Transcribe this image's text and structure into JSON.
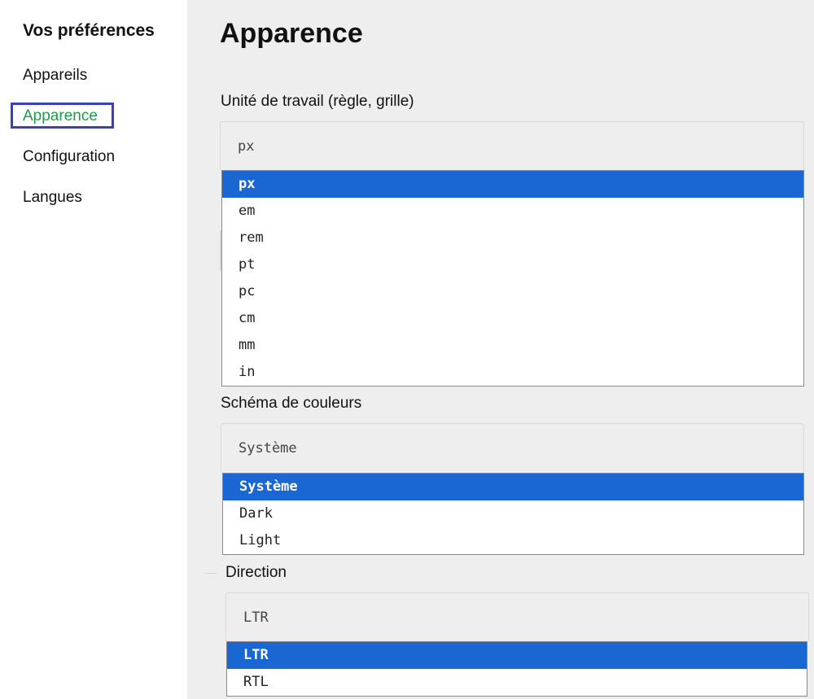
{
  "sidebar": {
    "title": "Vos préférences",
    "items": [
      {
        "label": "Appareils"
      },
      {
        "label": "Apparence"
      },
      {
        "label": "Configuration"
      },
      {
        "label": "Langues"
      }
    ],
    "active_index": 1
  },
  "main": {
    "page_title": "Apparence",
    "unit": {
      "label": "Unité de travail (règle, grille)",
      "value": "px",
      "options": [
        "px",
        "em",
        "rem",
        "pt",
        "pc",
        "cm",
        "mm",
        "in"
      ]
    },
    "color_scheme": {
      "label": "Schéma de couleurs",
      "value": "Système",
      "options": [
        "Système",
        "Dark",
        "Light"
      ]
    },
    "direction": {
      "label": "Direction",
      "value": "LTR",
      "options": [
        "LTR",
        "RTL"
      ]
    }
  },
  "colors": {
    "accent_active": "#1e9b4a",
    "selection": "#1a66d2",
    "focus_ring": "#3b3fc4"
  }
}
